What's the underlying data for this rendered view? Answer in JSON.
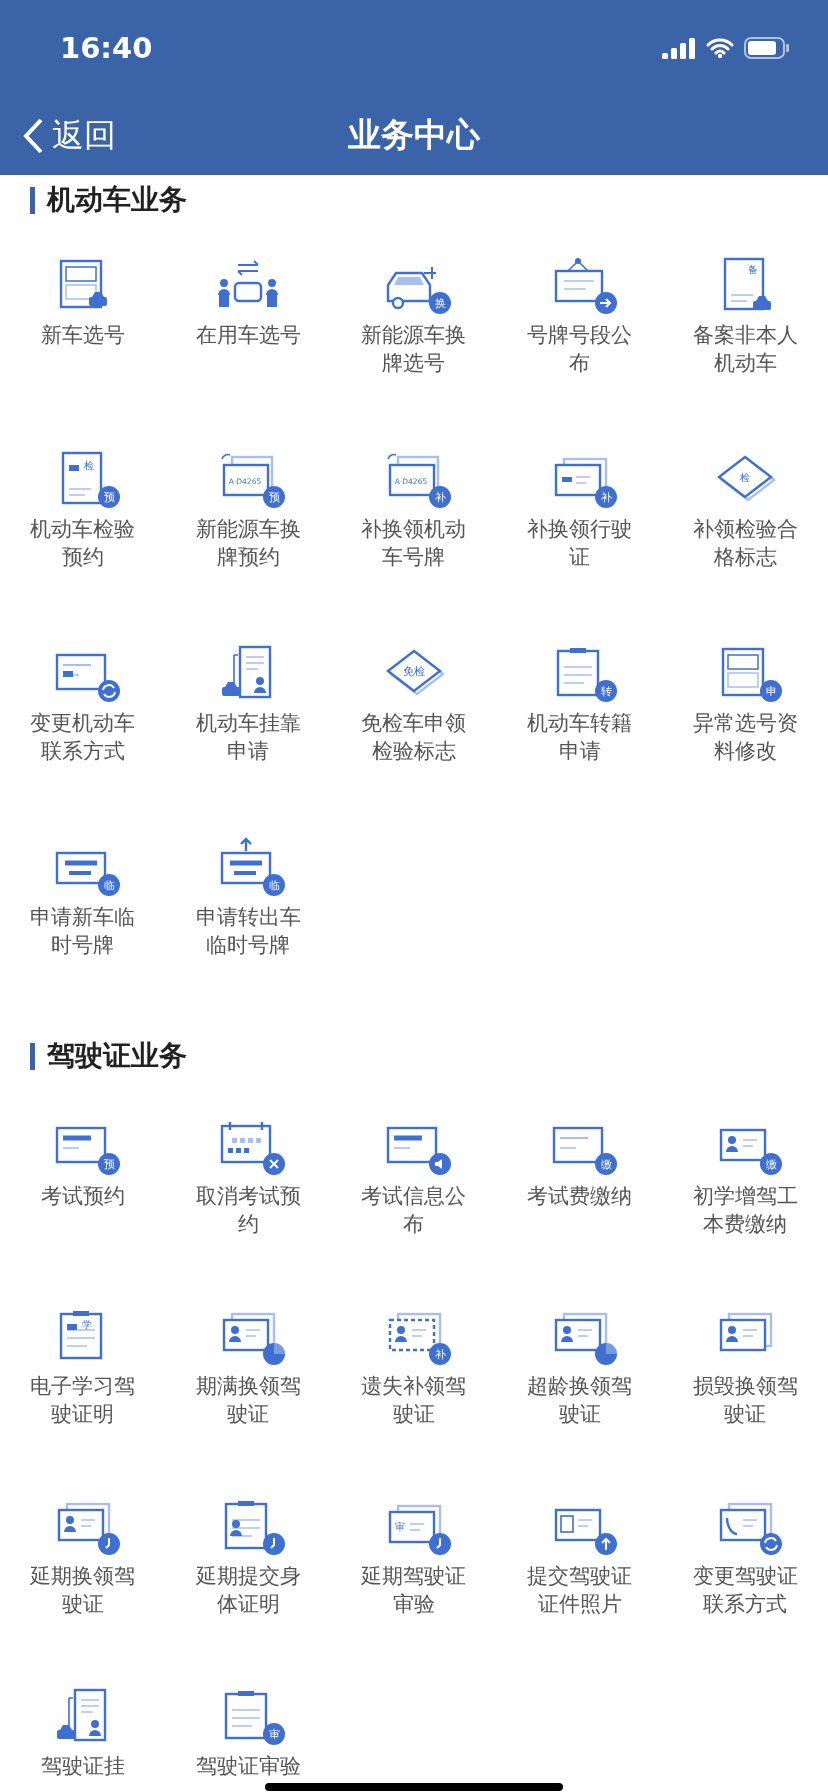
{
  "status_bar": {
    "time": "16:40"
  },
  "nav": {
    "back": "返回",
    "title": "业务中心"
  },
  "sections": [
    {
      "title": "机动车业务",
      "items": [
        {
          "label": "新车选号",
          "kind": "platescar"
        },
        {
          "label": "在用车选号",
          "kind": "peoplecar"
        },
        {
          "label": "新能源车换牌选号",
          "kind": "evcar",
          "badge": "换"
        },
        {
          "label": "号牌号段公布",
          "kind": "sign"
        },
        {
          "label": "备案非本人机动车",
          "kind": "doccar",
          "tag": "备"
        },
        {
          "label": "机动车检验预约",
          "kind": "doc",
          "tag": "检",
          "badge": "预"
        },
        {
          "label": "新能源车换牌预约",
          "kind": "platestack",
          "plate": "A·D4265",
          "badge": "预"
        },
        {
          "label": "补换领机动车号牌",
          "kind": "platestack",
          "plate": "A·D4265",
          "badge": "补"
        },
        {
          "label": "补换领行驶证",
          "kind": "cardstack",
          "badge": "补"
        },
        {
          "label": "补领检验合格标志",
          "kind": "diamond",
          "tag": "检"
        },
        {
          "label": "变更机动车联系方式",
          "kind": "card"
        },
        {
          "label": "机动车挂靠申请",
          "kind": "hitch"
        },
        {
          "label": "免检车申领检验标志",
          "kind": "diamond",
          "tag": "免检"
        },
        {
          "label": "机动车转籍申请",
          "kind": "clipboard",
          "badge": "转"
        },
        {
          "label": "异常选号资料修改",
          "kind": "plates",
          "badge": "申"
        },
        {
          "label": "申请新车临时号牌",
          "kind": "tempplate",
          "badge": "临"
        },
        {
          "label": "申请转出车临时号牌",
          "kind": "outplate",
          "badge": "临"
        }
      ]
    },
    {
      "title": "驾驶证业务",
      "items": [
        {
          "label": "考试预约",
          "kind": "screen",
          "badge": "预"
        },
        {
          "label": "取消考试预约",
          "kind": "calendar"
        },
        {
          "label": "考试信息公布",
          "kind": "speaker"
        },
        {
          "label": "考试费缴纳",
          "kind": "cardlines",
          "badge": "缴"
        },
        {
          "label": "初学增驾工本费缴纳",
          "kind": "personcard",
          "badge": "缴"
        },
        {
          "label": "电子学习驾驶证明",
          "kind": "study",
          "tag": "学"
        },
        {
          "label": "期满换领驾驶证",
          "kind": "expiry"
        },
        {
          "label": "遗失补领驾驶证",
          "kind": "dashed",
          "badge": "补"
        },
        {
          "label": "超龄换领驾驶证",
          "kind": "expiry"
        },
        {
          "label": "损毁换领驾驶证",
          "kind": "broken"
        },
        {
          "label": "延期换领驾驶证",
          "kind": "delaycard"
        },
        {
          "label": "延期提交身体证明",
          "kind": "delayhealth"
        },
        {
          "label": "延期驾驶证审验",
          "kind": "delaystack",
          "tag": "审"
        },
        {
          "label": "提交驾驶证证件照片",
          "kind": "photo"
        },
        {
          "label": "变更驾驶证联系方式",
          "kind": "phone"
        },
        {
          "label": "驾驶证挂",
          "kind": "hitch"
        },
        {
          "label": "驾驶证审验",
          "kind": "clipboard",
          "badge": "审"
        }
      ]
    }
  ]
}
